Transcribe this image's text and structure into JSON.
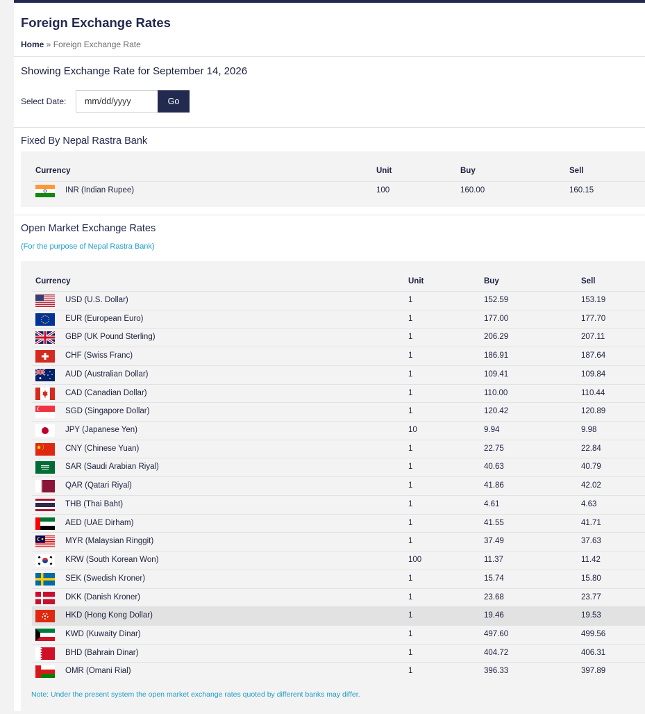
{
  "header": {
    "title": "Foreign Exchange Rates",
    "breadcrumb_home": "Home",
    "breadcrumb_sep": " » ",
    "breadcrumb_current": "Foreign Exchange Rate"
  },
  "date_filter": {
    "showing_text": "Showing Exchange Rate for September 14, 2026",
    "label": "Select Date:",
    "placeholder": "mm/dd/yyyy",
    "go_label": "Go"
  },
  "fixed": {
    "title": "Fixed By Nepal Rastra Bank",
    "columns": [
      "Currency",
      "Unit",
      "Buy",
      "Sell"
    ],
    "rows": [
      {
        "flag": "india-flag-icon",
        "currency": "INR (Indian Rupee)",
        "unit": "100",
        "buy": "160.00",
        "sell": "160.15"
      }
    ]
  },
  "open_market": {
    "title": "Open Market Exchange Rates",
    "subtitle": "(For the purpose of Nepal Rastra Bank)",
    "columns": [
      "Currency",
      "Unit",
      "Buy",
      "Sell"
    ],
    "rows": [
      {
        "flag": "usa-flag-icon",
        "currency": "USD (U.S. Dollar)",
        "unit": "1",
        "buy": "152.59",
        "sell": "153.19"
      },
      {
        "flag": "eu-flag-icon",
        "currency": "EUR (European Euro)",
        "unit": "1",
        "buy": "177.00",
        "sell": "177.70"
      },
      {
        "flag": "uk-flag-icon",
        "currency": "GBP (UK Pound Sterling)",
        "unit": "1",
        "buy": "206.29",
        "sell": "207.11"
      },
      {
        "flag": "switzerland-flag-icon",
        "currency": "CHF (Swiss Franc)",
        "unit": "1",
        "buy": "186.91",
        "sell": "187.64"
      },
      {
        "flag": "australia-flag-icon",
        "currency": "AUD (Australian Dollar)",
        "unit": "1",
        "buy": "109.41",
        "sell": "109.84"
      },
      {
        "flag": "canada-flag-icon",
        "currency": "CAD (Canadian Dollar)",
        "unit": "1",
        "buy": "110.00",
        "sell": "110.44"
      },
      {
        "flag": "singapore-flag-icon",
        "currency": "SGD (Singapore Dollar)",
        "unit": "1",
        "buy": "120.42",
        "sell": "120.89"
      },
      {
        "flag": "japan-flag-icon",
        "currency": "JPY (Japanese Yen)",
        "unit": "10",
        "buy": "9.94",
        "sell": "9.98"
      },
      {
        "flag": "china-flag-icon",
        "currency": "CNY (Chinese Yuan)",
        "unit": "1",
        "buy": "22.75",
        "sell": "22.84"
      },
      {
        "flag": "saudi-arabia-flag-icon",
        "currency": "SAR (Saudi Arabian Riyal)",
        "unit": "1",
        "buy": "40.63",
        "sell": "40.79"
      },
      {
        "flag": "qatar-flag-icon",
        "currency": "QAR (Qatari Riyal)",
        "unit": "1",
        "buy": "41.86",
        "sell": "42.02"
      },
      {
        "flag": "thailand-flag-icon",
        "currency": "THB (Thai Baht)",
        "unit": "1",
        "buy": "4.61",
        "sell": "4.63"
      },
      {
        "flag": "uae-flag-icon",
        "currency": "AED (UAE Dirham)",
        "unit": "1",
        "buy": "41.55",
        "sell": "41.71"
      },
      {
        "flag": "malaysia-flag-icon",
        "currency": "MYR (Malaysian Ringgit)",
        "unit": "1",
        "buy": "37.49",
        "sell": "37.63"
      },
      {
        "flag": "south-korea-flag-icon",
        "currency": "KRW (South Korean Won)",
        "unit": "100",
        "buy": "11.37",
        "sell": "11.42"
      },
      {
        "flag": "sweden-flag-icon",
        "currency": "SEK (Swedish Kroner)",
        "unit": "1",
        "buy": "15.74",
        "sell": "15.80"
      },
      {
        "flag": "denmark-flag-icon",
        "currency": "DKK (Danish Kroner)",
        "unit": "1",
        "buy": "23.68",
        "sell": "23.77"
      },
      {
        "flag": "hong-kong-flag-icon",
        "currency": "HKD (Hong Kong Dollar)",
        "unit": "1",
        "buy": "19.46",
        "sell": "19.53"
      },
      {
        "flag": "kuwait-flag-icon",
        "currency": "KWD (Kuwaity Dinar)",
        "unit": "1",
        "buy": "497.60",
        "sell": "499.56"
      },
      {
        "flag": "bahrain-flag-icon",
        "currency": "BHD (Bahrain Dinar)",
        "unit": "1",
        "buy": "404.72",
        "sell": "406.31"
      },
      {
        "flag": "oman-flag-icon",
        "currency": "OMR (Omani Rial)",
        "unit": "1",
        "buy": "396.33",
        "sell": "397.89"
      }
    ],
    "highlighted_row": "HKD (Hong Kong Dollar)",
    "note": "Note: Under the present system the open market exchange rates quoted by different banks may differ."
  },
  "colors": {
    "primary": "#232a4f",
    "accent": "#1e9cc9",
    "table_bg": "#f3f3f3",
    "row_hover": "#e2e2e2"
  }
}
